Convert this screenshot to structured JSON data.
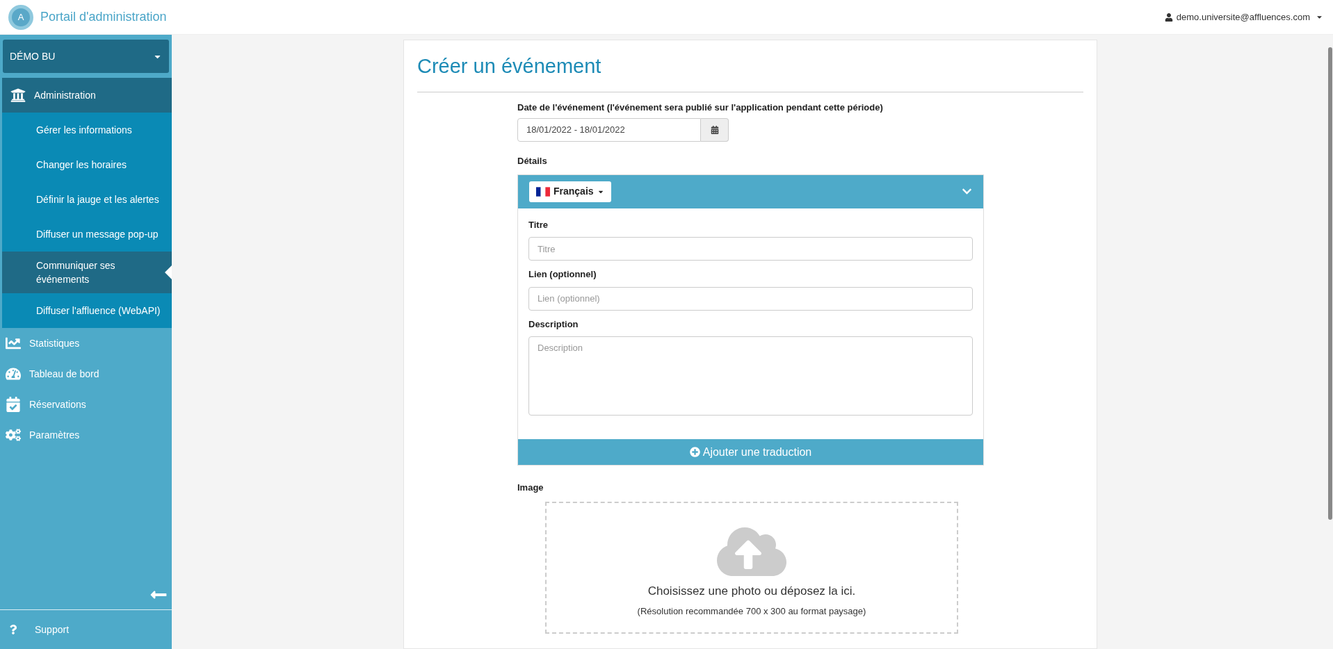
{
  "header": {
    "logo_mark": "A",
    "title": "Portail d'administration",
    "user": "demo.universite@affluences.com"
  },
  "sidebar": {
    "site_selector": "DÉMO BU",
    "items": [
      {
        "label": "Administration",
        "selected": true,
        "children": [
          {
            "label": "Gérer les informations",
            "selected": false
          },
          {
            "label": "Changer les horaires",
            "selected": false
          },
          {
            "label": "Définir la jauge et les alertes",
            "selected": false
          },
          {
            "label": "Diffuser un message pop-up",
            "selected": false
          },
          {
            "label": "Communiquer ses événements",
            "selected": true
          },
          {
            "label": "Diffuser l'affluence (WebAPI)",
            "selected": false
          }
        ]
      },
      {
        "label": "Statistiques",
        "selected": false
      },
      {
        "label": "Tableau de bord",
        "selected": false
      },
      {
        "label": "Réservations",
        "selected": false
      },
      {
        "label": "Paramètres",
        "selected": false
      }
    ],
    "footer": {
      "label": "Support"
    }
  },
  "form": {
    "title": "Créer un événement",
    "date": {
      "label": "Date de l'événement (l'événement sera publié sur l'application pendant cette période)",
      "value": "18/01/2022 - 18/01/2022"
    },
    "details": {
      "label": "Détails",
      "language": "Français",
      "fields": [
        {
          "kind": "input",
          "label": "Titre",
          "placeholder": "Titre"
        },
        {
          "kind": "input",
          "label": "Lien (optionnel)",
          "placeholder": "Lien (optionnel)"
        },
        {
          "kind": "textarea",
          "label": "Description",
          "placeholder": "Description"
        }
      ],
      "add_translation": "Ajouter une traduction"
    },
    "image": {
      "label": "Image",
      "prompt": "Choisissez une photo ou déposez la ici.",
      "hint": "(Résolution recommandée 700 x 300 au format paysage)"
    }
  }
}
